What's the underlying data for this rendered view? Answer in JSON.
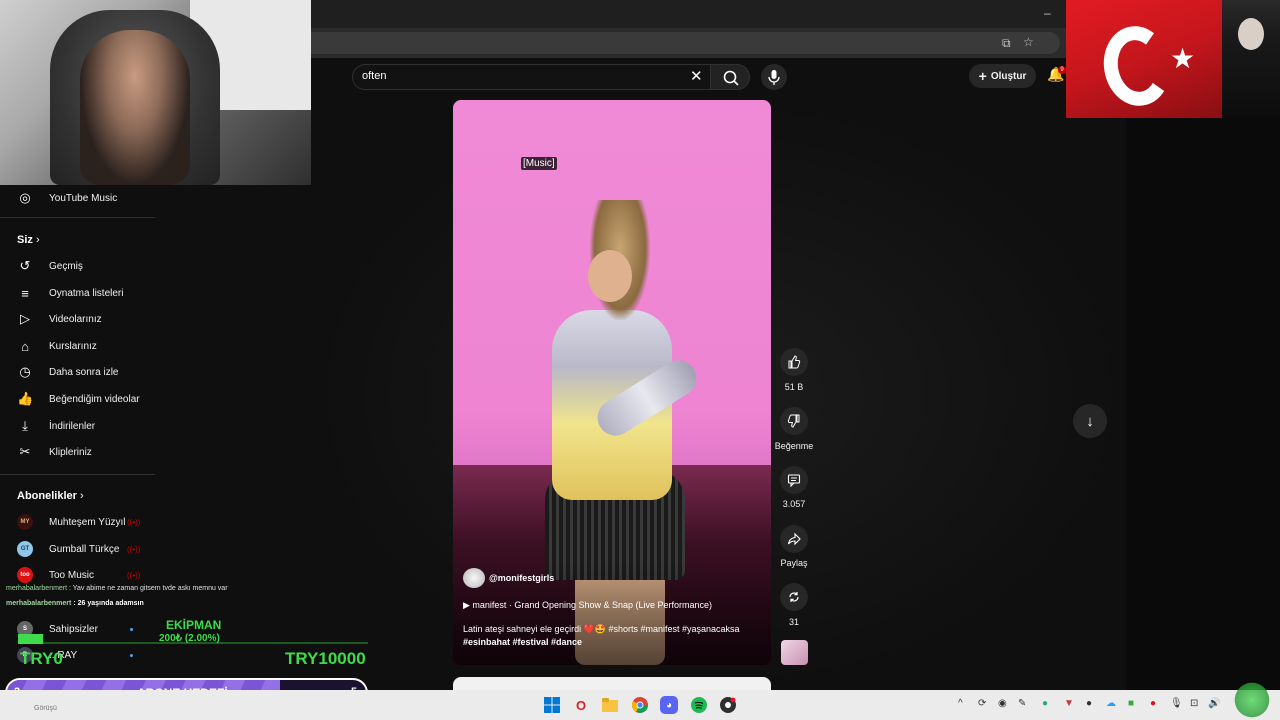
{
  "search": {
    "query": "often"
  },
  "header": {
    "create_label": "Oluştur",
    "notification_count": "9"
  },
  "sidebar": {
    "top_item": {
      "label": "YouTube Music",
      "icon": "youtube-music-icon"
    },
    "you_section": "Siz",
    "you_items": [
      {
        "label": "Geçmiş",
        "icon": "history-icon"
      },
      {
        "label": "Oynatma listeleri",
        "icon": "playlists-icon"
      },
      {
        "label": "Videolarınız",
        "icon": "your-videos-icon"
      },
      {
        "label": "Kurslarınız",
        "icon": "courses-icon"
      },
      {
        "label": "Daha sonra izle",
        "icon": "watch-later-icon"
      },
      {
        "label": "Beğendiğim videolar",
        "icon": "liked-videos-icon"
      },
      {
        "label": "İndirilenler",
        "icon": "downloads-icon"
      },
      {
        "label": "Klipleriniz",
        "icon": "clips-icon"
      }
    ],
    "subs_section": "Abonelikler",
    "subscriptions": [
      {
        "label": "Muhteşem Yüzyıl",
        "avatar": "MY",
        "live": true
      },
      {
        "label": "Gumball Türkçe",
        "avatar": "GT",
        "live": true
      },
      {
        "label": "Too Music",
        "avatar": "too",
        "live": true
      },
      {
        "label": "Sahipsizler",
        "avatar": "S",
        "live": false
      },
      {
        "label": "...RAY",
        "avatar": "R",
        "live": false
      }
    ]
  },
  "stream_overlay": {
    "chat": [
      {
        "name": "merhabalarbenmert",
        "message": ": Yav abime ne zaman gitsem tvde askı memnu var"
      },
      {
        "name": "merhabalarbenmert",
        "message": ": 26 yaşında adamsın"
      }
    ],
    "goal_title": "EKİPMAN",
    "goal_progress_text": "200₺ (2.00%)",
    "goal_progress": 0.02,
    "goal_left": "TRY0",
    "goal_right": "TRY10000",
    "abone_left": "2",
    "abone_title": "ABONE HEDEFİ",
    "abone_right": "5",
    "abone_progress": 0.4
  },
  "short": {
    "caption": "[Music]",
    "channel": "@monifestgirls",
    "music": "manifest · Grand Opening Show & Snap (Live Performance)",
    "description_line1": "Latin ateşi sahneyi ele geçirdi ❤️🤩 #shorts #manifest #yaşanacaksa",
    "description_line2": "#esinbahat #festival #dance"
  },
  "actions": {
    "like_count": "51 B",
    "dislike_label": "Beğenme",
    "comment_count": "3.057",
    "share_label": "Paylaş",
    "remix_count": "31"
  },
  "taskbar": {
    "search_hint": "Görüşü",
    "apps": [
      "windows-start-icon",
      "opera-icon",
      "file-explorer-icon",
      "chrome-icon",
      "discord-icon",
      "spotify-icon",
      "obs-icon"
    ]
  },
  "colors": {
    "accent_red": "#cc0000",
    "goal_green": "#3ddc4a",
    "abone_purple": "#7a55d6",
    "short_pink": "#ee84d2"
  }
}
